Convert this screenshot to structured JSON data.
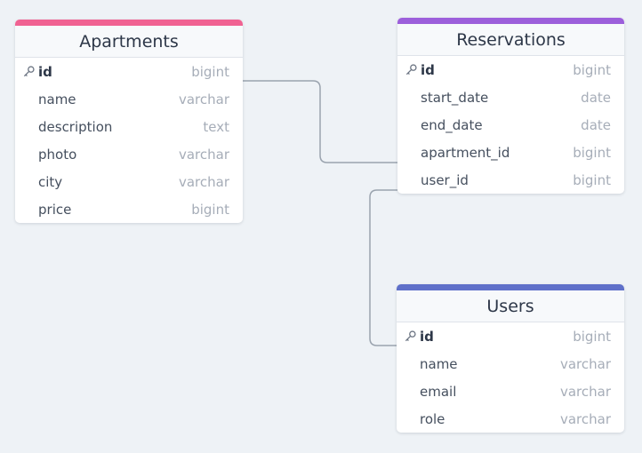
{
  "colors": {
    "background": "#eef2f6",
    "connector": "#9aa3ae",
    "apartments_accent": "#f06292",
    "reservations_accent": "#9c5fdb",
    "users_accent": "#5f70c9"
  },
  "icons": {
    "primary_key": "key-icon"
  },
  "tables": {
    "apartments": {
      "title": "Apartments",
      "fields": [
        {
          "name": "id",
          "type": "bigint",
          "primary_key": true
        },
        {
          "name": "name",
          "type": "varchar"
        },
        {
          "name": "description",
          "type": "text"
        },
        {
          "name": "photo",
          "type": "varchar"
        },
        {
          "name": "city",
          "type": "varchar"
        },
        {
          "name": "price",
          "type": "bigint"
        }
      ]
    },
    "reservations": {
      "title": "Reservations",
      "fields": [
        {
          "name": "id",
          "type": "bigint",
          "primary_key": true
        },
        {
          "name": "start_date",
          "type": "date"
        },
        {
          "name": "end_date",
          "type": "date"
        },
        {
          "name": "apartment_id",
          "type": "bigint"
        },
        {
          "name": "user_id",
          "type": "bigint"
        }
      ]
    },
    "users": {
      "title": "Users",
      "fields": [
        {
          "name": "id",
          "type": "bigint",
          "primary_key": true
        },
        {
          "name": "name",
          "type": "varchar"
        },
        {
          "name": "email",
          "type": "varchar"
        },
        {
          "name": "role",
          "type": "varchar"
        }
      ]
    }
  },
  "relations": [
    {
      "from": "reservations.apartment_id",
      "to": "apartments.id"
    },
    {
      "from": "reservations.user_id",
      "to": "users.id"
    }
  ]
}
